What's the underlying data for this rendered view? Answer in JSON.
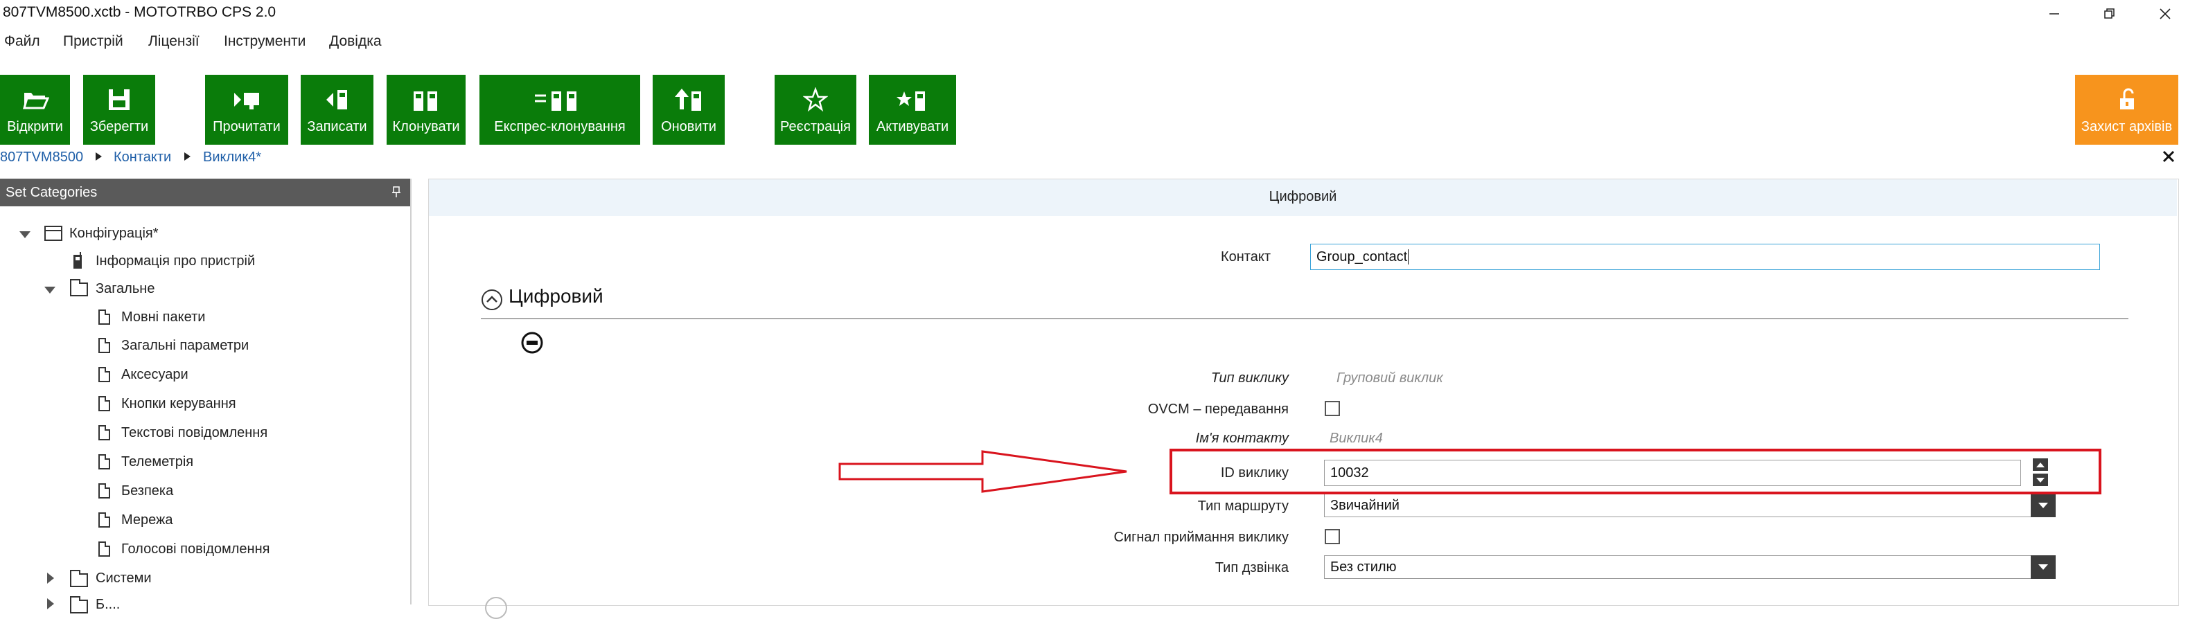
{
  "window": {
    "title": "807TVM8500.xctb - MOTOTRBO CPS 2.0"
  },
  "menu": [
    "Файл",
    "Пристрій",
    "Ліцензії",
    "Інструменти",
    "Довідка"
  ],
  "toolbar": {
    "open": "Відкрити",
    "save": "Зберегти",
    "read": "Прочитати",
    "write": "Записати",
    "clone": "Клонувати",
    "express_clone": "Експрес-клонування",
    "update": "Оновити",
    "register": "Реєстрація",
    "activate": "Активувати",
    "archive_protect": "Захист архівів"
  },
  "breadcrumb": [
    "807TVM8500",
    "Контакти",
    "Виклик4*"
  ],
  "categories": {
    "header": "Set Categories",
    "tree": {
      "config": "Конфігурація*",
      "device_info": "Інформація про пристрій",
      "general": "Загальне",
      "general_items": [
        "Мовні пакети",
        "Загальні параметри",
        "Аксесуари",
        "Кнопки керування",
        "Текстові повідомлення",
        "Телеметрія",
        "Безпека",
        "Мережа",
        "Голосові повідомлення"
      ],
      "systems": "Системи",
      "cut_off": "Б...."
    }
  },
  "main": {
    "section_header": "Цифровий",
    "contact_label": "Контакт",
    "contact_value": "Group_contact",
    "group_title": "Цифровий",
    "fields": {
      "call_type_label": "Тип виклику",
      "call_type_value": "Груповий виклик",
      "ovcm_label": "OVCM – передавання",
      "contact_name_label": "Ім'я контакту",
      "contact_name_value": "Виклик4",
      "call_id_label": "ID виклику",
      "call_id_value": "10032",
      "route_type_label": "Тип маршруту",
      "route_type_value": "Звичайний",
      "call_receive_alert_label": "Сигнал приймання виклику",
      "ring_type_label": "Тип дзвінка",
      "ring_type_value": "Без стилю"
    }
  },
  "annotation_colors": {
    "highlight": "#d9141e"
  }
}
